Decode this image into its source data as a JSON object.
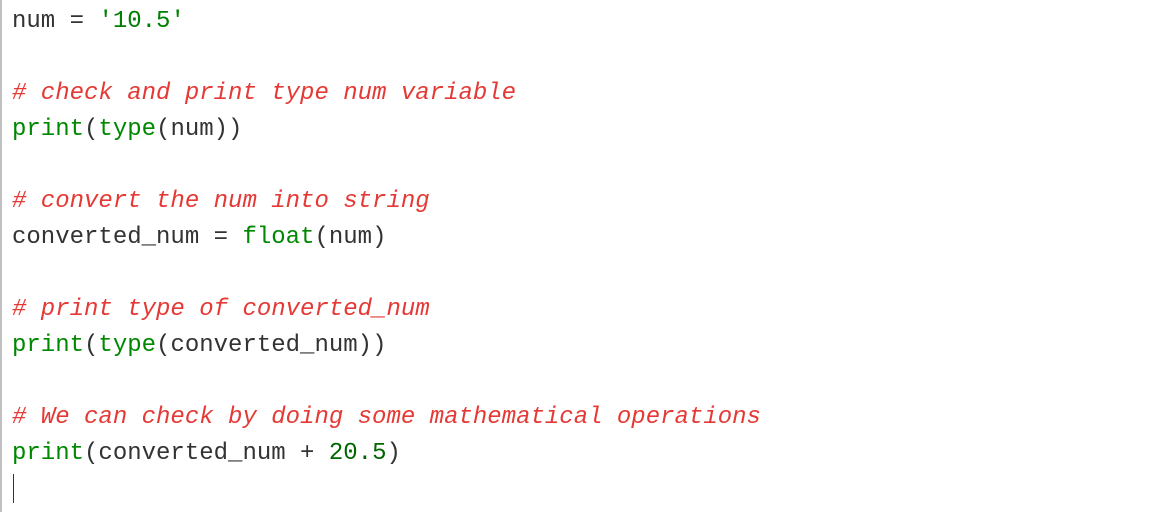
{
  "code": {
    "line1": {
      "var": "num",
      "eq": " = ",
      "string": "'10.5'"
    },
    "line3_comment": "# check and print type num variable",
    "line4": {
      "print": "print",
      "p1": "(",
      "type": "type",
      "p2": "(",
      "var": "num",
      "p3": "))"
    },
    "line6_comment": "# convert the num into string",
    "line7": {
      "var": "converted_num",
      "eq": " = ",
      "func": "float",
      "p1": "(",
      "arg": "num",
      "p2": ")"
    },
    "line9_comment": "# print type of converted_num",
    "line10": {
      "print": "print",
      "p1": "(",
      "type": "type",
      "p2": "(",
      "var": "converted_num",
      "p3": "))"
    },
    "line12_comment": "# We can check by doing some mathematical operations",
    "line13": {
      "print": "print",
      "p1": "(",
      "var": "converted_num",
      "plus": " + ",
      "num": "20.5",
      "p2": ")"
    }
  }
}
